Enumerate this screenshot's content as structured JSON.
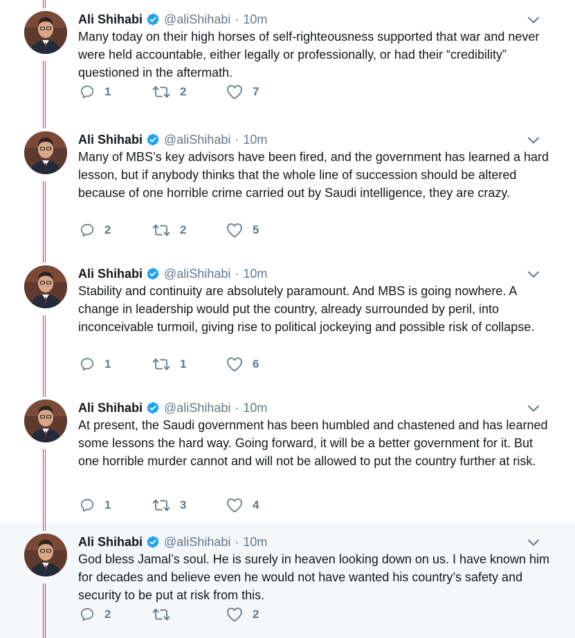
{
  "colors": {
    "thread_line": "#e0245e",
    "verified": "#1da1f2",
    "secondary_text": "#657786",
    "highlight_bg": "#f5f8fa"
  },
  "icons": {
    "reply": "reply-icon",
    "retweet": "retweet-icon",
    "like": "heart-icon",
    "verified": "verified-badge-icon",
    "menu": "chevron-down-icon"
  },
  "tweets": [
    {
      "name": "Ali Shihabi",
      "handle": "@aliShihabi",
      "separator": "·",
      "time": "10m",
      "text": "Many today on their high horses of self-righteousness supported that war and never were held accountable, either legally or professionally, or had their “credibility” questioned in the aftermath.",
      "replies": "1",
      "retweets": "2",
      "likes": "7"
    },
    {
      "name": "Ali Shihabi",
      "handle": "@aliShihabi",
      "separator": "·",
      "time": "10m",
      "text": "Many of MBS’s key advisors have been fired, and the government has learned a hard lesson, but if anybody thinks that the whole line of succession should be altered because of one horrible crime carried out by Saudi intelligence, they are crazy.",
      "replies": "2",
      "retweets": "2",
      "likes": "5"
    },
    {
      "name": "Ali Shihabi",
      "handle": "@aliShihabi",
      "separator": "·",
      "time": "10m",
      "text": "Stability and continuity are absolutely paramount. And MBS is going nowhere. A change in leadership would put the country, already surrounded by peril, into inconceivable turmoil, giving rise to political jockeying and possible risk of collapse.",
      "replies": "1",
      "retweets": "1",
      "likes": "6"
    },
    {
      "name": "Ali Shihabi",
      "handle": "@aliShihabi",
      "separator": "·",
      "time": "10m",
      "text": "At present, the Saudi government has been humbled and chastened and has learned some lessons the hard way. Going forward, it will be a better government for it. But one horrible murder cannot and will not be allowed to put the country further at risk.",
      "replies": "1",
      "retweets": "3",
      "likes": "4"
    },
    {
      "name": "Ali Shihabi",
      "handle": "@aliShihabi",
      "separator": "·",
      "time": "10m",
      "text": "God bless Jamal’s soul. He is surely in heaven looking down on us. I have known him for decades and believe even he would not have wanted his country’s safety and security to be put at risk from this.",
      "replies": "2",
      "retweets": "",
      "likes": "2"
    }
  ]
}
